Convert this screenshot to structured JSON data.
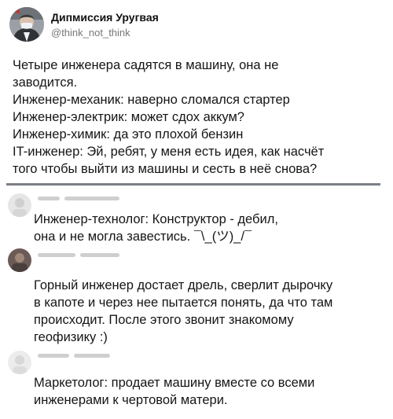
{
  "post": {
    "author_name": "Дипмиссия Уругвая",
    "author_handle": "@think_not_think",
    "body_lines": [
      "Четыре инженера садятся в машину, она не",
      "заводится.",
      "Инженер-механик: наверно сломался стартер",
      "Инженер-электрик: может сдох аккум?",
      "Инженер-химик: да это плохой бензин",
      "IT-инженер: Эй, ребят, у меня есть идея, как насчёт",
      "того чтобы выйти из машины и сесть в неё снова?"
    ]
  },
  "replies": [
    {
      "avatar_icon": "blurred-avatar-icon",
      "lines": [
        "Инженер-технолог: Конструктор - дебил,",
        "она и не могла завестись. ¯\\_(ツ)_/¯"
      ]
    },
    {
      "avatar_icon": "blurred-avatar-icon",
      "lines": [
        "Горный инженер достает дрель, сверлит дырочку",
        "в капоте и через нее пытается понять, да что там",
        "происходит. После этого звонит знакомому",
        "геофизику :)"
      ]
    },
    {
      "avatar_icon": "blurred-avatar-icon",
      "lines": [
        "Маркетолог: продает машину вместе со всеми",
        "инженерами к чертовой матери."
      ]
    }
  ],
  "colors": {
    "text": "#151515",
    "handle": "#777777",
    "divider": "#7a7f86",
    "redacted": "#cfcfcf"
  }
}
